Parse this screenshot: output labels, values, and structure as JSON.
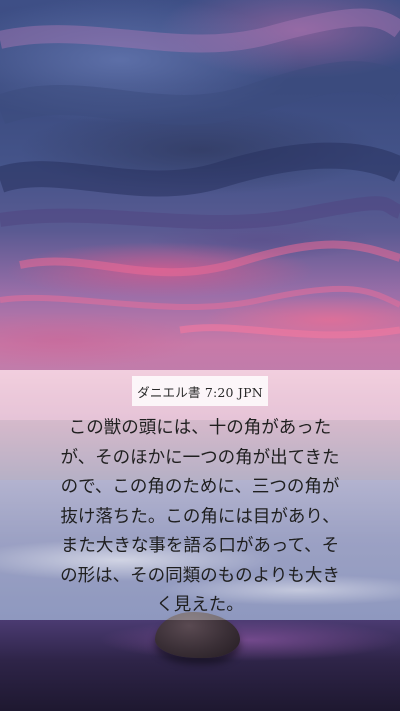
{
  "wallpaper": {
    "reference": "ダニエル書 7:20 JPN",
    "verse_lines": [
      "この獣の頭には、十の角があった",
      "が、そのほかに一つの角が出てきた",
      "ので、この角のために、三つの角が",
      "抜け落ちた。この角には目があり、",
      "また大きな事を語る口があって、そ",
      "の形は、その同類のものよりも大き",
      "く見えた。"
    ]
  },
  "colors": {
    "sky_top": "#3e4f86",
    "sky_pink": "#c87aa8",
    "sea": "#5766a0",
    "shore": "#2e2448",
    "panel_overlay": "rgba(255,255,255,0.32)",
    "text": "#1f1f1f"
  }
}
